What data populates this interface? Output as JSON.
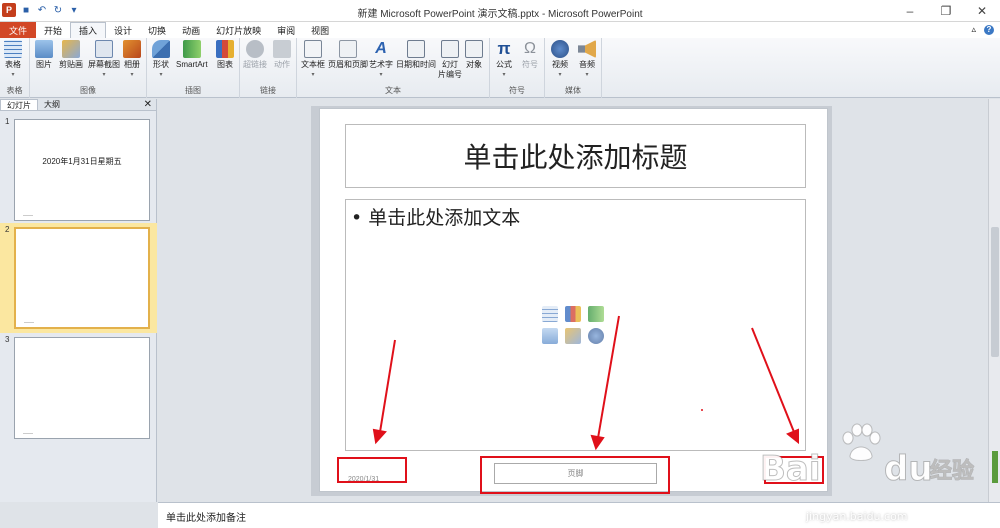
{
  "window": {
    "title": "新建 Microsoft PowerPoint 演示文稿.pptx - Microsoft PowerPoint"
  },
  "ribbon_tabs": [
    {
      "label": "文件"
    },
    {
      "label": "开始"
    },
    {
      "label": "插入"
    },
    {
      "label": "设计"
    },
    {
      "label": "切换"
    },
    {
      "label": "动画"
    },
    {
      "label": "幻灯片放映"
    },
    {
      "label": "审阅"
    },
    {
      "label": "视图"
    }
  ],
  "active_tab": "插入",
  "groups": {
    "table": {
      "label": "表格",
      "buttons": [
        {
          "label": "表格",
          "icon": "table-icon"
        }
      ]
    },
    "images": {
      "label": "图像",
      "buttons": [
        {
          "label": "图片",
          "icon": "picture-icon"
        },
        {
          "label": "剪贴画",
          "icon": "clipart-icon"
        },
        {
          "label": "屏幕截图",
          "icon": "screenshot-icon"
        },
        {
          "label": "相册",
          "icon": "album-icon"
        }
      ]
    },
    "illustrations": {
      "label": "插图",
      "buttons": [
        {
          "label": "形状",
          "icon": "shapes-icon"
        },
        {
          "label": "SmartArt",
          "icon": "smartart-icon"
        },
        {
          "label": "图表",
          "icon": "chart-icon"
        }
      ]
    },
    "links": {
      "label": "链接",
      "buttons": [
        {
          "label": "超链接",
          "icon": "hyperlink-icon"
        },
        {
          "label": "动作",
          "icon": "action-icon"
        }
      ]
    },
    "text": {
      "label": "文本",
      "buttons": [
        {
          "label": "文本框",
          "icon": "textbox-icon"
        },
        {
          "label": "页眉和页脚",
          "icon": "header-footer-icon"
        },
        {
          "label": "艺术字",
          "icon": "wordart-icon"
        },
        {
          "label": "日期和时间",
          "icon": "datetime-icon"
        },
        {
          "label": "幻灯",
          "label2": "片编号",
          "icon": "slide-number-icon"
        },
        {
          "label": "对象",
          "icon": "object-icon"
        }
      ]
    },
    "symbols": {
      "label": "符号",
      "buttons": [
        {
          "label": "公式",
          "icon": "equation-icon"
        },
        {
          "label": "符号",
          "icon": "symbol-icon"
        }
      ]
    },
    "media": {
      "label": "媒体",
      "buttons": [
        {
          "label": "视频",
          "icon": "video-icon"
        },
        {
          "label": "音频",
          "icon": "audio-icon"
        }
      ]
    }
  },
  "left_panel": {
    "tabs": [
      "幻灯片",
      "大纲"
    ],
    "close": "✕",
    "slides": [
      {
        "number": "1",
        "text": "2020年1月31日星期五"
      },
      {
        "number": "2",
        "text": ""
      },
      {
        "number": "3",
        "text": ""
      }
    ]
  },
  "slide": {
    "title_placeholder": "单击此处添加标题",
    "body_placeholder": "• 单击此处添加文本",
    "date": "2020/1/31",
    "footer": "页脚"
  },
  "notes": {
    "placeholder": "单击此处添加备注"
  },
  "watermark": {
    "main": "Bai du经验",
    "sub": "jingyan.baidu.com"
  },
  "colors": {
    "file_tab": "#d24726",
    "annotation_red": "#e0101a",
    "selected_thumb": "#fbe7a0"
  }
}
